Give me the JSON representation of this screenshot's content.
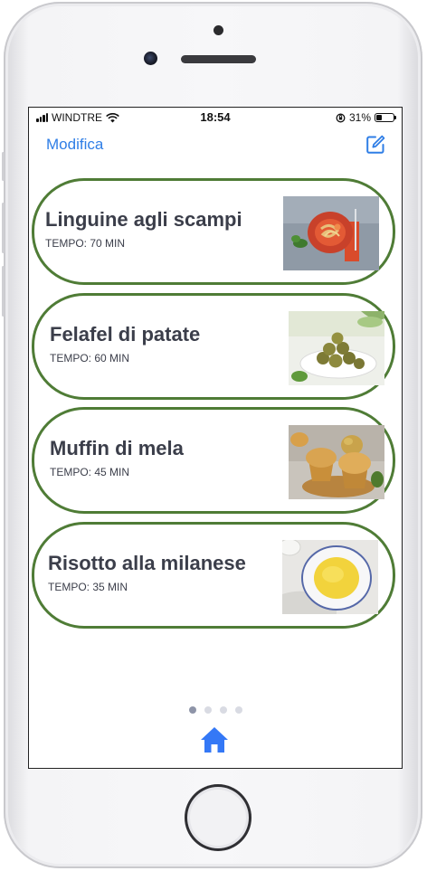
{
  "status_bar": {
    "carrier": "WINDTRE",
    "time": "18:54",
    "battery": "31%",
    "battery_level": 0.31
  },
  "nav": {
    "edit_label": "Modifica",
    "compose_icon": "compose-icon"
  },
  "recipes": [
    {
      "name": "Linguine agli scampi",
      "time": "TEMPO: 70 MIN"
    },
    {
      "name": "Felafel di patate",
      "time": "TEMPO: 60 MIN"
    },
    {
      "name": "Muffin di mela",
      "time": "TEMPO: 45 MIN"
    },
    {
      "name": "Risotto alla milanese",
      "time": "TEMPO: 35 MIN"
    }
  ],
  "pager": {
    "pages": 4,
    "current": 1
  },
  "tab_bar": {
    "home_icon": "home-icon"
  },
  "colors": {
    "accent": "#2f7ee6",
    "card_border": "#4f7c36",
    "text": "#3b3e4a",
    "home_icon": "#3478f6"
  }
}
